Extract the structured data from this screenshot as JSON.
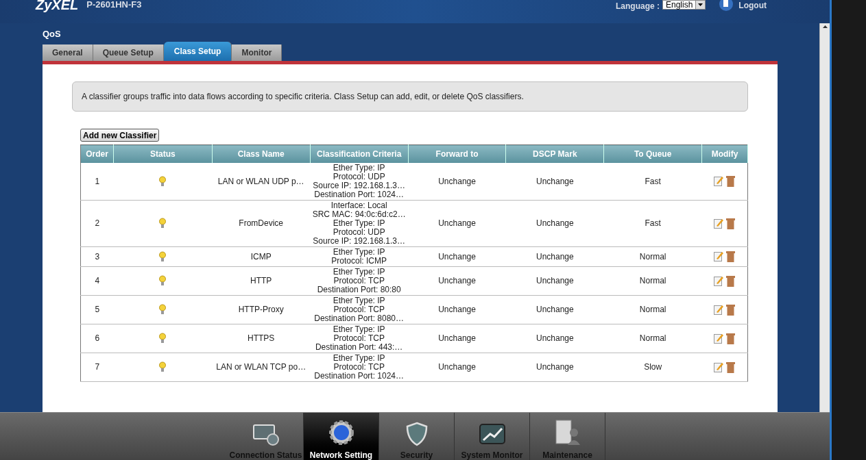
{
  "header": {
    "logo": "ZyXEL",
    "model": "P-2601HN-F3",
    "language_label": "Language :",
    "language": "English",
    "logout": "Logout"
  },
  "page_title": "QoS",
  "tabs": [
    {
      "label": "General",
      "selected": false
    },
    {
      "label": "Queue Setup",
      "selected": false
    },
    {
      "label": "Class Setup",
      "selected": true
    },
    {
      "label": "Monitor",
      "selected": false
    }
  ],
  "description": "A classifier groups traffic into data flows according to specific criteria. Class Setup can add, edit, or delete QoS classifiers.",
  "add_button": "Add new Classifier",
  "table": {
    "columns": [
      "Order",
      "Status",
      "Class Name",
      "Classification Criteria",
      "Forward to",
      "DSCP Mark",
      "To Queue",
      "Modify"
    ],
    "rows": [
      {
        "order": "1",
        "active": true,
        "name": "LAN or WLAN UDP p…",
        "criteria": [
          "Ether Type: IP",
          "Protocol: UDP",
          "Source IP: 192.168.1.3…",
          "Destination Port: 1024…"
        ],
        "forward": "Unchange",
        "dscp": "Unchange",
        "queue": "Fast"
      },
      {
        "order": "2",
        "active": true,
        "name": "FromDevice",
        "criteria": [
          "Interface: Local",
          "SRC MAC: 94:0c:6d:c2…",
          "Ether Type: IP",
          "Protocol: UDP",
          "Source IP: 192.168.1.3…"
        ],
        "forward": "Unchange",
        "dscp": "Unchange",
        "queue": "Fast"
      },
      {
        "order": "3",
        "active": true,
        "name": "ICMP",
        "criteria": [
          "Ether Type: IP",
          "Protocol: ICMP"
        ],
        "forward": "Unchange",
        "dscp": "Unchange",
        "queue": "Normal"
      },
      {
        "order": "4",
        "active": true,
        "name": "HTTP",
        "criteria": [
          "Ether Type: IP",
          "Protocol: TCP",
          "Destination Port: 80:80"
        ],
        "forward": "Unchange",
        "dscp": "Unchange",
        "queue": "Normal"
      },
      {
        "order": "5",
        "active": true,
        "name": "HTTP-Proxy",
        "criteria": [
          "Ether Type: IP",
          "Protocol: TCP",
          "Destination Port: 8080…"
        ],
        "forward": "Unchange",
        "dscp": "Unchange",
        "queue": "Normal"
      },
      {
        "order": "6",
        "active": true,
        "name": "HTTPS",
        "criteria": [
          "Ether Type: IP",
          "Protocol: TCP",
          "Destination Port: 443:…"
        ],
        "forward": "Unchange",
        "dscp": "Unchange",
        "queue": "Normal"
      },
      {
        "order": "7",
        "active": true,
        "name": "LAN or WLAN TCP po…",
        "criteria": [
          "Ether Type: IP",
          "Protocol: TCP",
          "Destination Port: 1024…"
        ],
        "forward": "Unchange",
        "dscp": "Unchange",
        "queue": "Slow"
      }
    ]
  },
  "bottom_nav": [
    {
      "kind": "monitor",
      "label": "Connection Status",
      "selected": false
    },
    {
      "kind": "gear",
      "label": "Network Setting",
      "selected": true
    },
    {
      "kind": "shield",
      "label": "Security",
      "selected": false
    },
    {
      "kind": "chart",
      "label": "System Monitor",
      "selected": false
    },
    {
      "kind": "maintenance",
      "label": "Maintenance",
      "selected": false
    }
  ]
}
